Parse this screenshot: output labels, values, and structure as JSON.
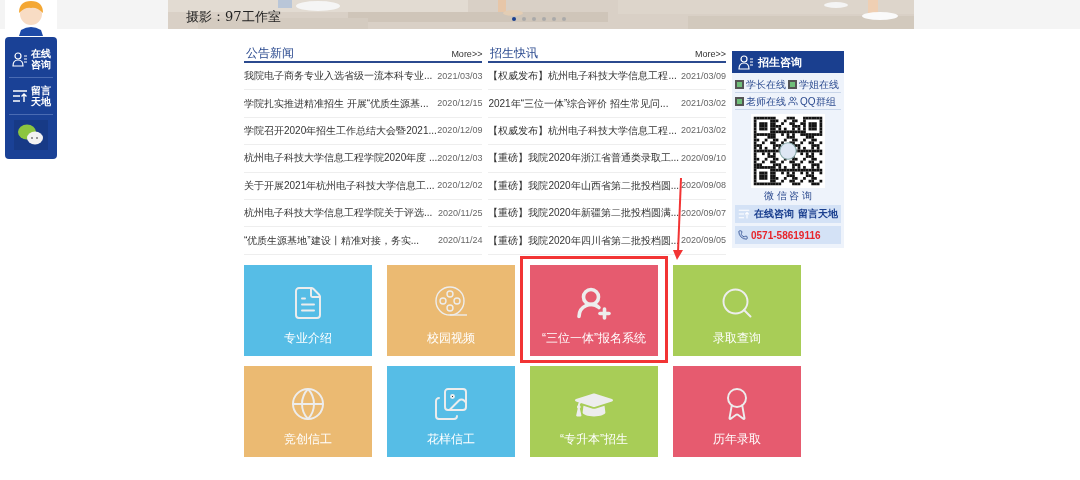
{
  "banner": {
    "caption": "摄影：97工作室",
    "dots": [
      {
        "selected": true
      },
      {
        "selected": false
      },
      {
        "selected": false
      },
      {
        "selected": false
      },
      {
        "selected": false
      },
      {
        "selected": false
      }
    ]
  },
  "float_bar": {
    "items": [
      {
        "kind": "consult",
        "label": "在线咨询"
      },
      {
        "kind": "message",
        "label": "留言天地"
      },
      {
        "kind": "wechat"
      }
    ]
  },
  "news_lists": [
    {
      "title": "公告新闻",
      "more": "More>>",
      "items": [
        {
          "title": "我院电子商务专业入选省级一流本科专业...",
          "date": "2021/03/03"
        },
        {
          "title": "学院扎实推进精准招生 开展“优质生源基...",
          "date": "2020/12/15"
        },
        {
          "title": "学院召开2020年招生工作总结大会暨2021...",
          "date": "2020/12/09"
        },
        {
          "title": "杭州电子科技大学信息工程学院2020年度 ...",
          "date": "2020/12/03"
        },
        {
          "title": "关于开展2021年杭州电子科技大学信息工...",
          "date": "2020/12/02"
        },
        {
          "title": "杭州电子科技大学信息工程学院关于评选...",
          "date": "2020/11/25"
        },
        {
          "title": "“优质生源基地”建设丨精准对接，务实...",
          "date": "2020/11/24"
        }
      ]
    },
    {
      "title": "招生快讯",
      "more": "More>>",
      "items": [
        {
          "title": "【权威发布】杭州电子科技大学信息工程...",
          "date": "2021/03/09"
        },
        {
          "title": "2021年“三位一体”综合评价 招生常见问...",
          "date": "2021/03/02"
        },
        {
          "title": "【权威发布】杭州电子科技大学信息工程...",
          "date": "2021/03/02"
        },
        {
          "title": "【重磅】我院2020年浙江省普通类录取工...",
          "date": "2020/09/10"
        },
        {
          "title": "【重磅】我院2020年山西省第二批投档圆...",
          "date": "2020/09/08"
        },
        {
          "title": "【重磅】我院2020年新疆第二批投档圆满...",
          "date": "2020/09/07"
        },
        {
          "title": "【重磅】我院2020年四川省第二批投档圆...",
          "date": "2020/09/05"
        }
      ]
    }
  ],
  "consult": {
    "title": "招生咨询",
    "links": [
      {
        "kind": "chat",
        "label": "学长在线"
      },
      {
        "kind": "chat",
        "label": "学姐在线"
      },
      {
        "kind": "chat",
        "label": "老师在线"
      },
      {
        "kind": "group",
        "label": "QQ群组"
      }
    ],
    "qr_caption": "微 信 咨 询",
    "actions": [
      "在线咨询",
      "留言天地"
    ],
    "phone": "0571-58619116"
  },
  "tiles": [
    {
      "label": "专业介绍",
      "kind": "document",
      "color": "#56bde6",
      "highlighted": false
    },
    {
      "label": "校园视频",
      "kind": "film",
      "color": "#ebba72",
      "highlighted": false
    },
    {
      "label": "“三位一体”报名系统",
      "kind": "user-add",
      "color": "#e65b6f",
      "highlighted": true
    },
    {
      "label": "录取查询",
      "kind": "search",
      "color": "#a8cd57",
      "highlighted": false
    },
    {
      "label": "竞创信工",
      "kind": "globe",
      "color": "#ebba72",
      "highlighted": false
    },
    {
      "label": "花样信工",
      "kind": "images",
      "color": "#56bde6",
      "highlighted": false
    },
    {
      "label": "“专升本”招生",
      "kind": "cap",
      "color": "#a8cd57",
      "highlighted": false
    },
    {
      "label": "历年录取",
      "kind": "award",
      "color": "#e65b6f",
      "highlighted": false
    }
  ]
}
